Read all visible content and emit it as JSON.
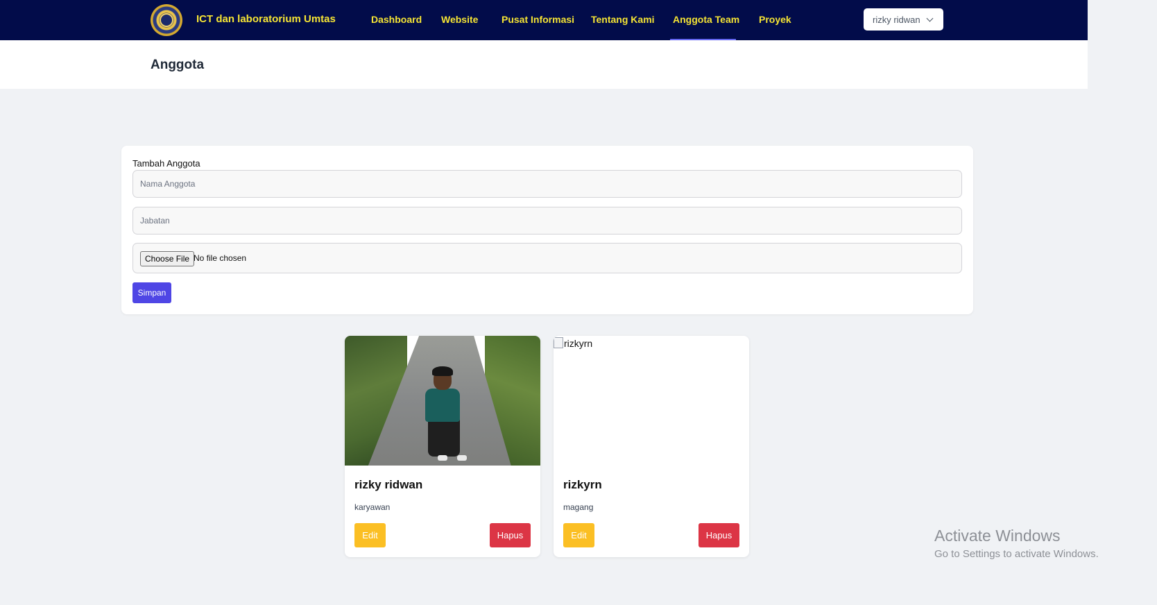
{
  "navbar": {
    "brand": "ICT dan laboratorium Umtas",
    "links": [
      {
        "label": "Dashboard"
      },
      {
        "label": "Website"
      },
      {
        "label": "Pusat Informasi"
      },
      {
        "label": "Tentang Kami"
      },
      {
        "label": "Anggota Team",
        "active": true
      },
      {
        "label": "Proyek"
      }
    ],
    "user": {
      "name": "rizky ridwan",
      "icon": "chevron-down-icon"
    },
    "colors": {
      "background": "#020c4a",
      "link": "#f6e534",
      "active_underline": "#6366f1"
    }
  },
  "header": {
    "title": "Anggota"
  },
  "form": {
    "label": "Tambah Anggota",
    "name_placeholder": "Nama Anggota",
    "position_placeholder": "Jabatan",
    "file_button": "Choose File",
    "file_status": "No file chosen",
    "submit_label": "Simpan",
    "submit_color": "#4f46e5"
  },
  "members": [
    {
      "name": "rizky ridwan",
      "role": "karyawan",
      "photo": "person-photo",
      "edit_label": "Edit",
      "delete_label": "Hapus"
    },
    {
      "name": "rizkyrn",
      "role": "magang",
      "photo_alt": "rizkyrn",
      "edit_label": "Edit",
      "delete_label": "Hapus"
    }
  ],
  "button_colors": {
    "edit": "#fbbf24",
    "delete": "#dc3545"
  },
  "watermark": {
    "title": "Activate Windows",
    "subtitle": "Go to Settings to activate Windows."
  }
}
